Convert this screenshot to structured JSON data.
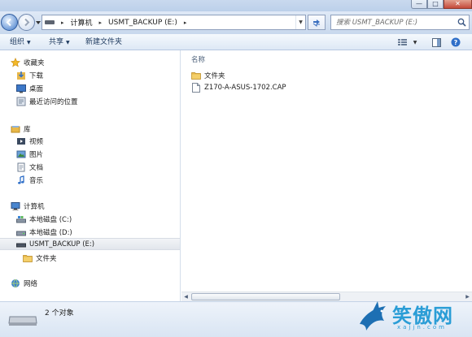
{
  "window": {
    "minimize_glyph": "—",
    "maximize_glyph": "□",
    "close_glyph": "✕"
  },
  "address": {
    "segments": [
      "计算机",
      "USMT_BACKUP (E:)"
    ]
  },
  "search": {
    "placeholder": "搜索 USMT_BACKUP (E:)"
  },
  "toolbar": {
    "organize": "组织",
    "share": "共享",
    "new_folder": "新建文件夹"
  },
  "nav": {
    "favorites": "收藏夹",
    "downloads": "下载",
    "desktop": "桌面",
    "recent": "最近访问的位置",
    "libraries": "库",
    "videos": "视频",
    "pictures": "图片",
    "documents": "文档",
    "music": "音乐",
    "computer": "计算机",
    "drive_c": "本地磁盘 (C:)",
    "drive_d": "本地磁盘 (D:)",
    "drive_e": "USMT_BACKUP (E:)",
    "folder": "文件夹",
    "network": "网络"
  },
  "content": {
    "column_name": "名称",
    "items": [
      {
        "name": "文件夹",
        "type": "folder"
      },
      {
        "name": "Z170-A-ASUS-1702.CAP",
        "type": "file"
      }
    ]
  },
  "status": {
    "count": "2 个对象"
  },
  "watermark": {
    "brand": "笑傲网",
    "url": "xajjn.com"
  },
  "colors": {
    "accent": "#2a9dd6",
    "folder": "#e8b84a",
    "chrome": "#c8d8ed"
  }
}
